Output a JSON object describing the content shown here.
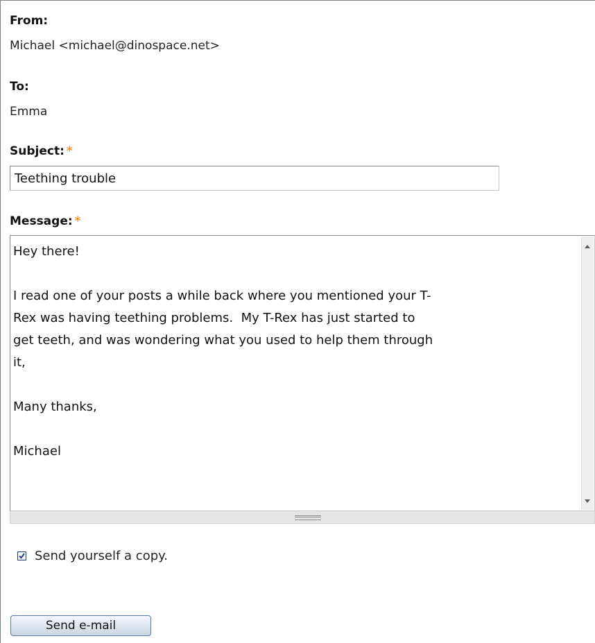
{
  "form": {
    "from_label": "From:",
    "from_value": "Michael <michael@dinospace.net>",
    "to_label": "To:",
    "to_value": "Emma",
    "subject_label": "Subject:",
    "subject_required": "*",
    "subject_value": "Teething trouble",
    "message_label": "Message:",
    "message_required": "*",
    "message_value": "Hey there!\n\nI read one of your posts a while back where you mentioned your T-\nRex was having teething problems.  My T-Rex has just started to\nget teeth, and was wondering what you used to help them through\nit,\n\nMany thanks,\n\nMichael",
    "copy_label": "Send yourself a copy.",
    "copy_checked": true,
    "send_label": "Send e-mail"
  },
  "icons": {
    "scroll_up": "scroll-up-arrow-icon",
    "scroll_down": "scroll-down-arrow-icon",
    "resize_grip": "resize-grip-icon",
    "checkmark": "checkmark-icon"
  },
  "colors": {
    "required_asterisk": "#f0932a",
    "checkbox_border": "#1e3a78",
    "checkmark": "#1f3f8f",
    "button_border": "#5b7aa8"
  }
}
